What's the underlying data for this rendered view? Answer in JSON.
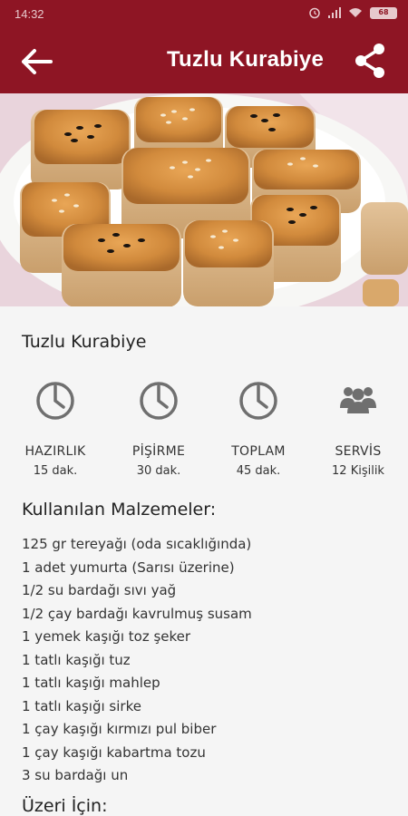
{
  "status_bar": {
    "time": "14:32",
    "icons": [
      "alarm-icon",
      "signal-icon",
      "wifi-icon",
      "battery-icon"
    ],
    "battery": "68"
  },
  "app_bar": {
    "title": "Tuzlu Kurabiye",
    "color": "#8e1524"
  },
  "recipe": {
    "name": "Tuzlu Kurabiye",
    "stats": [
      {
        "icon": "timer-icon",
        "label": "HAZIRLIK",
        "value": "15 dak."
      },
      {
        "icon": "timer-icon",
        "label": "PİŞİRME",
        "value": "30 dak."
      },
      {
        "icon": "timer-icon",
        "label": "TOPLAM",
        "value": "45 dak."
      },
      {
        "icon": "people-icon",
        "label": "SERVİS",
        "value": "12 Kişilik"
      }
    ],
    "ingredients_title": "Kullanılan Malzemeler:",
    "ingredients": [
      "125 gr tereyağı (oda sıcaklığında)",
      "1 adet yumurta (Sarısı üzerine)",
      "1/2 su bardağı sıvı yağ",
      "1/2 çay bardağı kavrulmuş susam",
      "1 yemek kaşığı toz şeker",
      "1 tatlı kaşığı tuz",
      "1 tatlı kaşığı mahlep",
      "1 tatlı kaşığı sirke",
      "1 çay kaşığı kırmızı pul biber",
      "1 çay kaşığı kabartma tozu",
      "3 su bardağı un"
    ],
    "topping_title": "Üzeri İçin:"
  }
}
